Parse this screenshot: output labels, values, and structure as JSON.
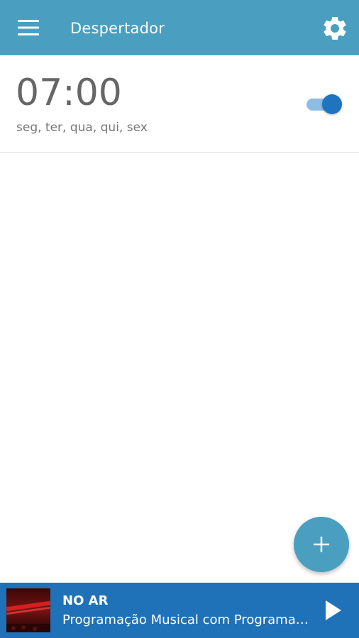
{
  "appbar": {
    "title": "Despertador",
    "menu_icon": "hamburger-menu-icon",
    "settings_icon": "gear-icon",
    "background": "#4a9fc0"
  },
  "alarms": [
    {
      "time": "07:00",
      "days": "seg, ter, qua, qui, sex",
      "enabled": true
    }
  ],
  "fab": {
    "icon": "plus-icon",
    "color": "#4a9fc0"
  },
  "player": {
    "status": "NO AR",
    "program": "Programação Musical com Programação Musical",
    "play_icon": "play-icon",
    "background": "#1f72b8"
  },
  "colors": {
    "toggle_thumb": "#1f74c0",
    "toggle_track": "#8dbde2"
  }
}
